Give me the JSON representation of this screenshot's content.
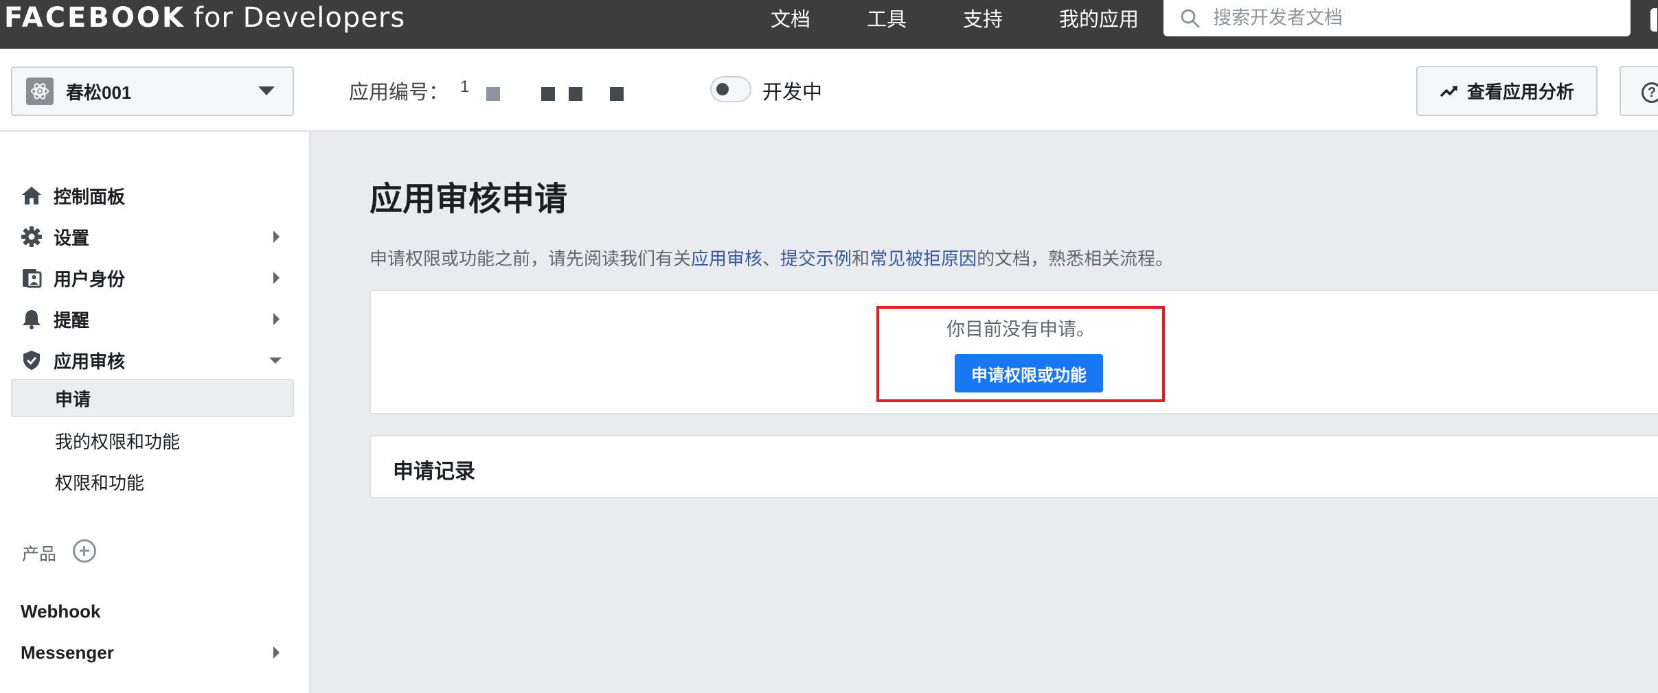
{
  "topbar": {
    "brand_main": "FACEBOOK",
    "brand_sub": "for Developers",
    "nav": [
      {
        "label": "文档"
      },
      {
        "label": "工具"
      },
      {
        "label": "支持"
      },
      {
        "label": "我的应用"
      }
    ],
    "search_placeholder": "搜索开发者文档"
  },
  "header": {
    "app_name": "春松001",
    "app_id_label": "应用编号：",
    "app_id_visible": "1",
    "mode_label": "开发中",
    "analytics_label": "查看应用分析",
    "help_glyph": "?"
  },
  "sidebar": {
    "items": [
      {
        "label": "控制面板",
        "icon": "home-icon"
      },
      {
        "label": "设置",
        "icon": "gear-icon"
      },
      {
        "label": "用户身份",
        "icon": "user-id-icon"
      },
      {
        "label": "提醒",
        "icon": "bell-icon"
      },
      {
        "label": "应用审核",
        "icon": "shield-check-icon"
      }
    ],
    "review_sub": [
      {
        "label": "申请",
        "active": true
      },
      {
        "label": "我的权限和功能"
      },
      {
        "label": "权限和功能"
      }
    ],
    "products_label": "产品",
    "products": [
      {
        "label": "Webhook"
      },
      {
        "label": "Messenger"
      }
    ]
  },
  "main": {
    "title": "应用审核申请",
    "intro": {
      "prefix": "申请权限或功能之前，请先阅读我们有关",
      "link1": "应用审核",
      "sep": "、",
      "link2": "提交示例",
      "and": "和",
      "link3": "常见被拒原因",
      "suffix": "的文档，熟悉相关流程。"
    },
    "empty_text": "你目前没有申请。",
    "request_button": "申请权限或功能",
    "history_title": "申请记录"
  },
  "colors": {
    "topbar_bg": "#3d3d3d",
    "accent": "#1877f2",
    "link": "#385898",
    "highlight": "#e41e26",
    "page_bg": "#e9ebee"
  }
}
